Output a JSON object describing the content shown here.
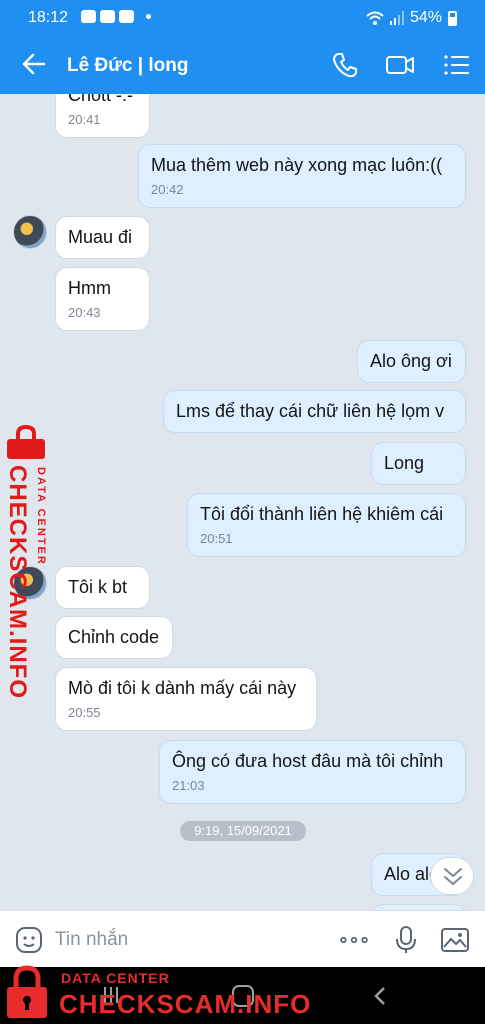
{
  "status": {
    "time": "18:12",
    "battery": "54%"
  },
  "header": {
    "title": "Lê Đức | long"
  },
  "messages": [
    {
      "dir": "in",
      "text": "Chött -.-",
      "time": "20:41"
    },
    {
      "dir": "out",
      "text": "Mua thêm web này xong mạc luôn:((",
      "time": "20:42"
    },
    {
      "dir": "in",
      "text": "Muau đi",
      "time": ""
    },
    {
      "dir": "in",
      "text": "Hmm",
      "time": "20:43"
    },
    {
      "dir": "out",
      "text": "Alo ông ơi",
      "time": ""
    },
    {
      "dir": "out",
      "text": "Lms để thay cái chữ liên hệ lọm v",
      "time": ""
    },
    {
      "dir": "out",
      "text": "Long",
      "time": ""
    },
    {
      "dir": "out",
      "text": "Tôi đổi thành liên hệ khiêm cái",
      "time": "20:51"
    },
    {
      "dir": "in",
      "text": "Tôi k bt",
      "time": ""
    },
    {
      "dir": "in",
      "text": "Chỉnh code",
      "time": ""
    },
    {
      "dir": "in",
      "text": "Mò đi tôi k dành mấy cái này",
      "time": "20:55"
    },
    {
      "dir": "out",
      "text": "Ông có đưa host đâu mà tôi chỉnh",
      "time": "21:03"
    },
    {
      "dir": "out",
      "text": "Alo alo",
      "time": ""
    }
  ],
  "date_separator": "9:19, 15/09/2021",
  "input": {
    "placeholder": "Tin nhắn"
  },
  "watermark": {
    "line1": "DATA CENTER",
    "line2": "CHECKSCAM.INFO"
  },
  "icons": {
    "header": [
      "back-arrow-icon",
      "phone-icon",
      "video-call-icon",
      "menu-list-icon"
    ],
    "input": [
      "sticker-icon",
      "more-icon",
      "microphone-icon",
      "image-icon"
    ],
    "nav": [
      "recent-apps-icon",
      "home-icon",
      "back-icon"
    ]
  },
  "colors": {
    "accent": "#1f8ff2",
    "bubble_out": "#def0ff",
    "bubble_in": "#ffffff",
    "chat_bg": "#dfe6ee",
    "watermark": "#e11a1a"
  }
}
